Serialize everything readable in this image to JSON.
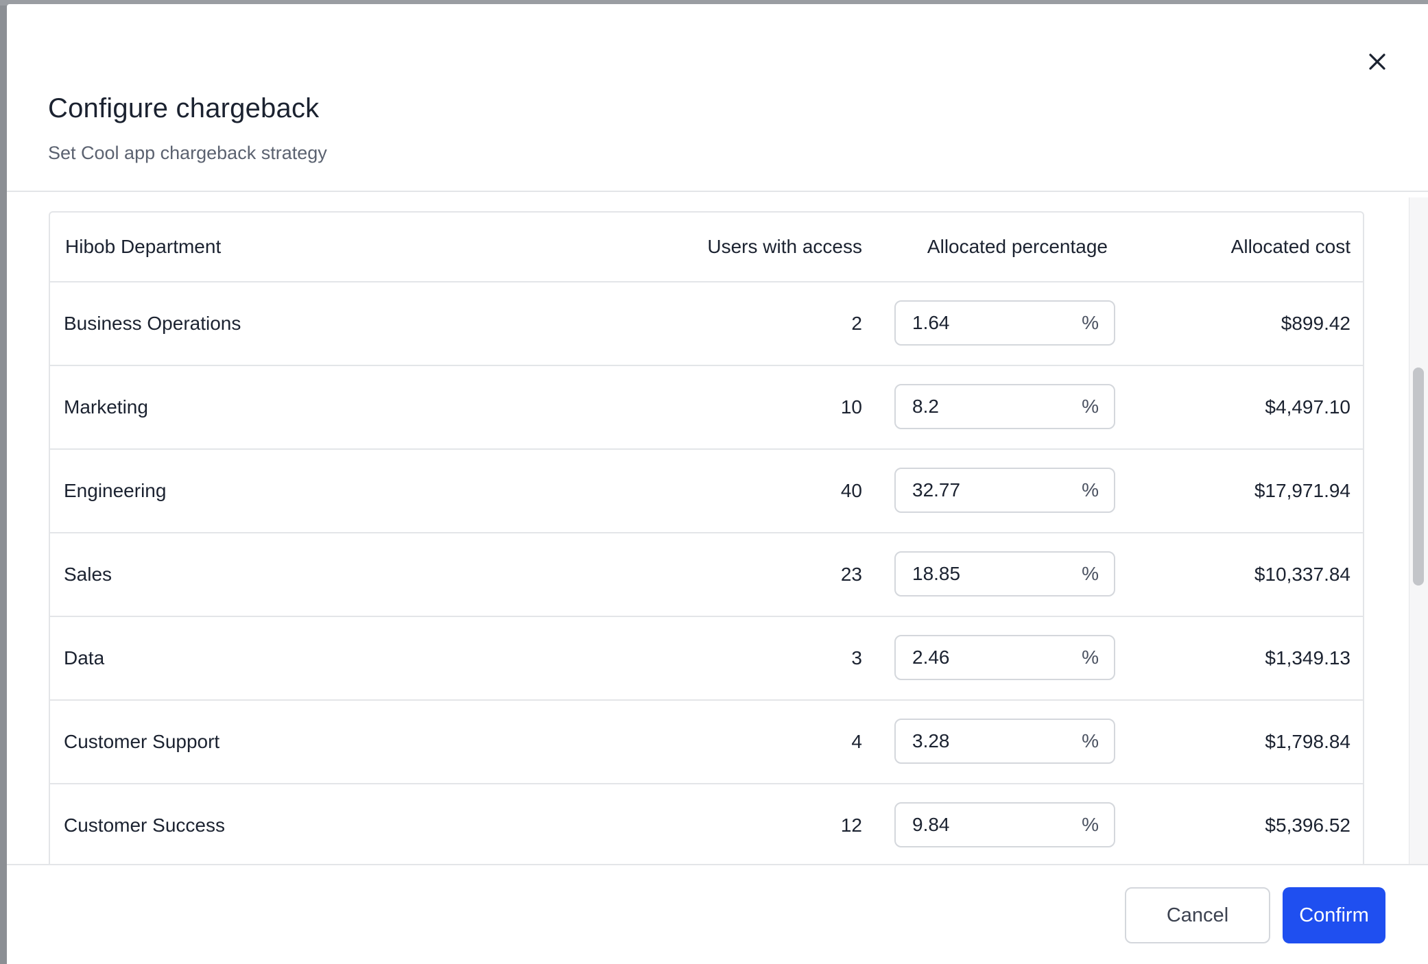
{
  "dialog": {
    "title": "Configure chargeback",
    "subtitle": "Set Cool app chargeback strategy",
    "close_icon": "close-icon"
  },
  "table": {
    "columns": {
      "department": "Hibob Department",
      "users": "Users with access",
      "percentage": "Allocated percentage",
      "cost": "Allocated cost"
    },
    "percent_suffix": "%",
    "rows": [
      {
        "department": "Business Operations",
        "users": "2",
        "percentage": "1.64",
        "cost": "$899.42"
      },
      {
        "department": "Marketing",
        "users": "10",
        "percentage": "8.2",
        "cost": "$4,497.10"
      },
      {
        "department": "Engineering",
        "users": "40",
        "percentage": "32.77",
        "cost": "$17,971.94"
      },
      {
        "department": "Sales",
        "users": "23",
        "percentage": "18.85",
        "cost": "$10,337.84"
      },
      {
        "department": "Data",
        "users": "3",
        "percentage": "2.46",
        "cost": "$1,349.13"
      },
      {
        "department": "Customer Support",
        "users": "4",
        "percentage": "3.28",
        "cost": "$1,798.84"
      },
      {
        "department": "Customer Success",
        "users": "12",
        "percentage": "9.84",
        "cost": "$5,396.52"
      }
    ]
  },
  "footer": {
    "cancel_label": "Cancel",
    "confirm_label": "Confirm"
  },
  "colors": {
    "primary": "#1f4ff0",
    "border": "#e3e5e8",
    "text": "#1b2230",
    "muted": "#5b6270"
  }
}
